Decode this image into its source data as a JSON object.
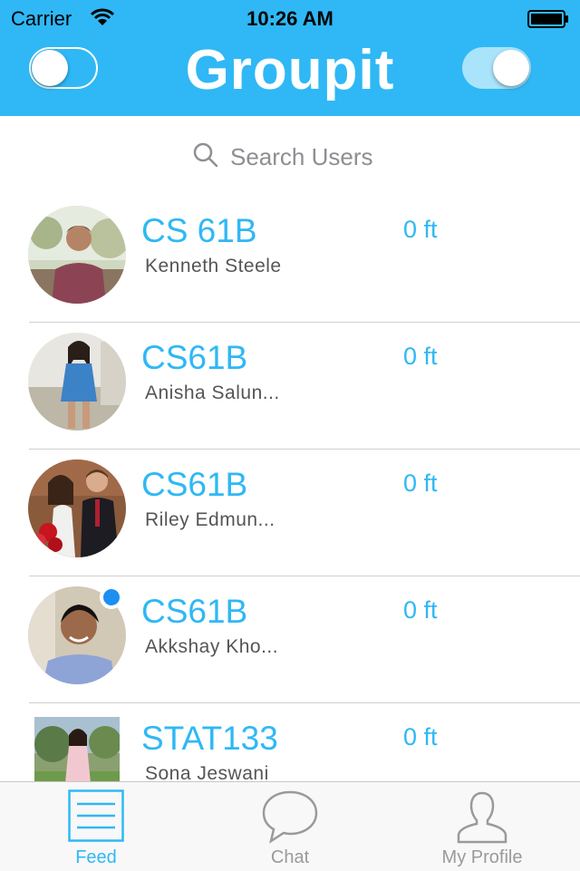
{
  "status_bar": {
    "carrier": "Carrier",
    "time": "10:26 AM",
    "wifi_icon": "wifi-icon",
    "battery_icon": "battery-icon"
  },
  "header": {
    "title": "Groupit",
    "background_color": "#2fb8f5",
    "left_toggle_on": false,
    "right_toggle_on": true
  },
  "search": {
    "placeholder": "Search Users",
    "icon": "search-icon"
  },
  "feed": {
    "items": [
      {
        "course": "CS 61B",
        "name": "Kenneth Steele",
        "distance": "0 ft",
        "online": false
      },
      {
        "course": "CS61B",
        "name": "Anisha Salun...",
        "distance": "0 ft",
        "online": false
      },
      {
        "course": "CS61B",
        "name": "Riley Edmun...",
        "distance": "0 ft",
        "online": false
      },
      {
        "course": "CS61B",
        "name": "Akkshay Kho...",
        "distance": "0 ft",
        "online": true
      },
      {
        "course": "STAT133",
        "name": "Sona Jeswani",
        "distance": "0 ft",
        "online": false
      }
    ]
  },
  "tabbar": {
    "tabs": [
      {
        "label": "Feed",
        "icon": "list-icon",
        "active": true
      },
      {
        "label": "Chat",
        "icon": "chat-bubble-icon",
        "active": false
      },
      {
        "label": "My Profile",
        "icon": "person-icon",
        "active": false
      }
    ],
    "active_color": "#2fb8f5",
    "inactive_color": "#9a9a9a"
  }
}
